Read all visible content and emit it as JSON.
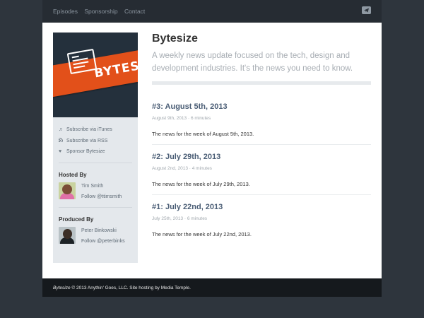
{
  "topnav": {
    "items": [
      "Episodes",
      "Sponsorship",
      "Contact"
    ],
    "share_icon": "paper-plane-icon"
  },
  "sidebar": {
    "cover_text": "BYTESIZE",
    "links": [
      {
        "icon": "music-note-icon",
        "label": "Subscribe via iTunes"
      },
      {
        "icon": "rss-icon",
        "label": "Subscribe via RSS"
      },
      {
        "icon": "heart-icon",
        "label": "Sponsor Bytesize"
      }
    ],
    "hosted_by": {
      "title": "Hosted By",
      "name": "Tim Smith",
      "follow": "Follow @ttimsmith"
    },
    "produced_by": {
      "title": "Produced By",
      "name": "Peter Binkowski",
      "follow": "Follow @peterbinks"
    }
  },
  "main": {
    "title": "Bytesize",
    "tagline": "A weekly news update focused on the tech, design and development industries. It's the news you need to know.",
    "episodes": [
      {
        "title": "#3: August 5th, 2013",
        "date": "August 9th, 2013",
        "duration": "6 minutes",
        "desc": "The news for the week of August 5th, 2013."
      },
      {
        "title": "#2: July 29th, 2013",
        "date": "August 2nd, 2013",
        "duration": "4 minutes",
        "desc": "The news for the week of July 29th, 2013."
      },
      {
        "title": "#1: July 22nd, 2013",
        "date": "July 25th, 2013",
        "duration": "6 minutes",
        "desc": "The news for the week of July 22nd, 2013."
      }
    ]
  },
  "footer": {
    "brand": "Bytesize",
    "text": " © 2013 Anythin' Goes, LLC. Site hosting by Media Temple."
  },
  "colors": {
    "background": "#2e353d",
    "accent_orange": "#e2501a",
    "episode_title": "#4a5d75"
  }
}
